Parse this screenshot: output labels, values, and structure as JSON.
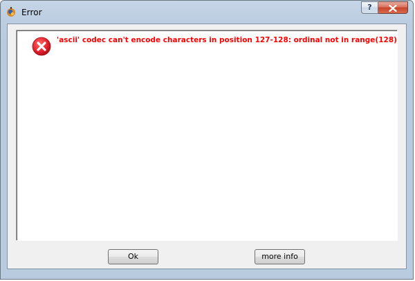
{
  "window": {
    "title": "Error",
    "help_glyph": "?",
    "close_glyph": "close-icon"
  },
  "message": {
    "icon": "error-circle-x-icon",
    "text": "'ascii' codec can't encode characters in position 127-128: ordinal not in range(128)"
  },
  "buttons": {
    "ok_label": "Ok",
    "more_info_label": "more info"
  },
  "colors": {
    "error_text": "#ff0000",
    "error_icon": "#e0202a"
  }
}
